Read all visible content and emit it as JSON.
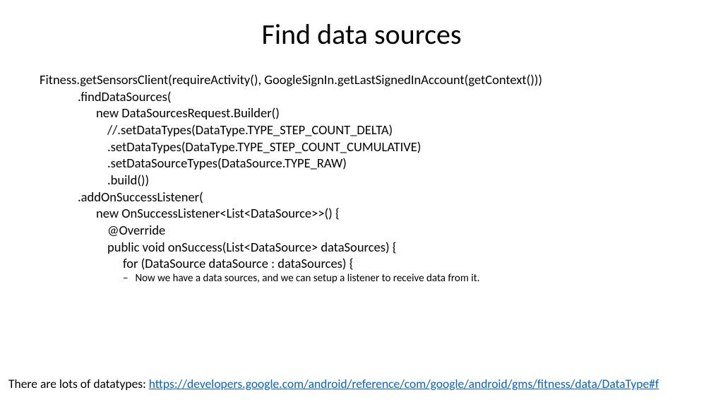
{
  "title": "Find data sources",
  "code": {
    "l1": "Fitness.getSensorsClient(requireActivity(), GoogleSignIn.getLastSignedInAccount(getContext()))",
    "l2": ".findDataSources(",
    "l3": "new DataSourcesRequest.Builder()",
    "l4": "//.setDataTypes(DataType.TYPE_STEP_COUNT_DELTA)",
    "l5": ".setDataTypes(DataType.TYPE_STEP_COUNT_CUMULATIVE)",
    "l6": ".setDataSourceTypes(DataSource.TYPE_RAW)",
    "l7": ".build())",
    "l8": ".addOnSuccessListener(",
    "l9": "new OnSuccessListener<List<DataSource>>() {",
    "l10": "@Override",
    "l11": "public void onSuccess(List<DataSource> dataSources) {",
    "l12": "for (DataSource dataSource : dataSources) {",
    "dash": "–",
    "note": "Now we have a data sources, and we can setup a listener to receive data from it."
  },
  "footer": {
    "lead": "There are lots of datatypes:  ",
    "link": "https://developers.google.com/android/reference/com/google/android/gms/fitness/data/DataType#f"
  }
}
